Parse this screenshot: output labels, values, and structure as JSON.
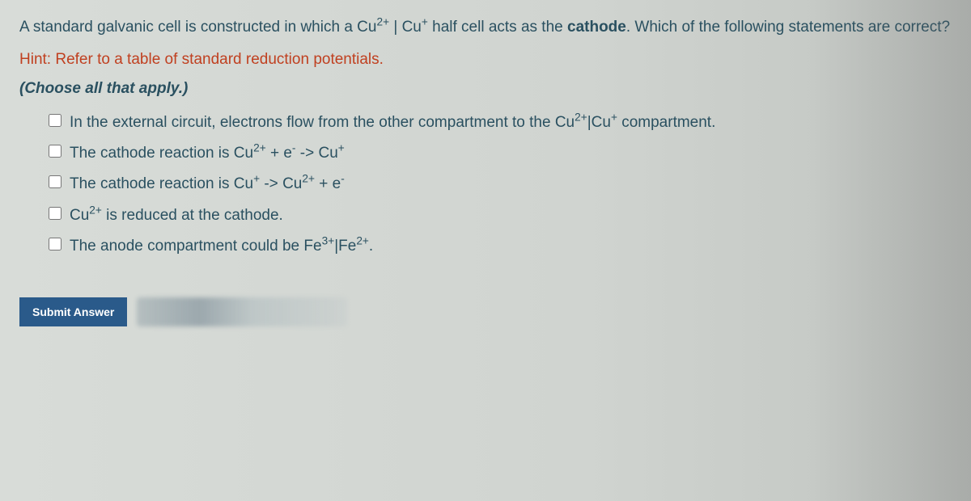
{
  "question": {
    "prefix": "A standard galvanic cell is constructed in which a ",
    "half1_a": "Cu",
    "half1_sup": "2+",
    "sep": " | ",
    "half2_a": "Cu",
    "half2_sup": "+",
    "after": " half cell acts as the ",
    "bold": "cathode",
    "tail": ". Which of the following statements are correct?"
  },
  "hint": "Hint: Refer to a table of standard reduction potentials.",
  "instruction": "(Choose all that apply.)",
  "options": {
    "opt1": {
      "pre": "In the external circuit, electrons flow from the other compartment to the ",
      "a": "Cu",
      "asup": "2+",
      "mid": "|",
      "b": "Cu",
      "bsup": "+",
      "post": " compartment."
    },
    "opt2": {
      "pre": "The cathode reaction is ",
      "a": "Cu",
      "asup": "2+",
      "mid": " + e",
      "esup": "-",
      "arrow": " -> ",
      "b": "Cu",
      "bsup": "+"
    },
    "opt3": {
      "pre": "The cathode reaction is ",
      "a": "Cu",
      "asup": "+",
      "arrow": " -> ",
      "b": "Cu",
      "bsup": "2+",
      "mid": " + e",
      "esup": "-"
    },
    "opt4": {
      "a": "Cu",
      "asup": "2+",
      "post": " is reduced at the cathode."
    },
    "opt5": {
      "pre": "The anode compartment could be ",
      "a": "Fe",
      "asup": "3+",
      "mid": "|",
      "b": "Fe",
      "bsup": "2+",
      "post": "."
    }
  },
  "submit_label": "Submit Answer"
}
